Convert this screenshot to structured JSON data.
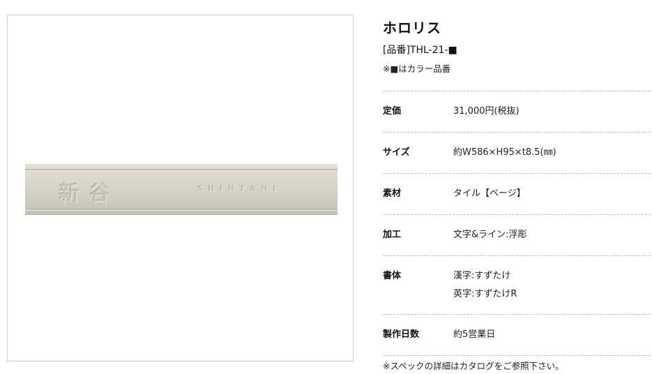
{
  "product": {
    "image_alt": "ホロリス 表札",
    "plate_text_kanji": "新谷",
    "plate_text_roman": "SHINTANI",
    "name": "ホロリス",
    "code": "[品番]THL-21-■",
    "color_note": "※■はカラー品番"
  },
  "specs": [
    {
      "label": "定価",
      "value": "31,000円(税抜)"
    },
    {
      "label": "サイズ",
      "value": "約W586×H95×t8.5(㎜)"
    },
    {
      "label": "素材",
      "value": "タイル【ベージ】"
    },
    {
      "label": "加工",
      "value": "文字&ライン:浮彫"
    },
    {
      "label": "書体",
      "value": "漢字:すずたけ",
      "value2": "英字:すずたけR"
    },
    {
      "label": "製作日数",
      "value": "約5営業日"
    }
  ],
  "footnote": "※スペックの詳細はカタログをご参照下さい。",
  "colors": {
    "plate": "#d5d3c9",
    "divider": "#bcbcbc"
  }
}
